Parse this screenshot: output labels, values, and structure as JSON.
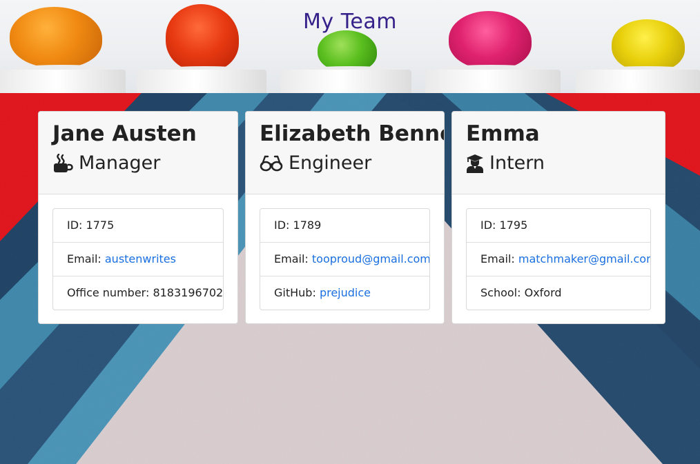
{
  "header": {
    "title": "My Team"
  },
  "cards": [
    {
      "name": "Jane Austen",
      "role": "Manager",
      "role_icon": "mug-icon",
      "id_label": "ID:",
      "id_value": "1775",
      "email_label": "Email:",
      "email_value": "austenwrites",
      "extra_label": "Office number:",
      "extra_value": "8183196702"
    },
    {
      "name": "Elizabeth Bennet",
      "role": "Engineer",
      "role_icon": "glasses-icon",
      "id_label": "ID:",
      "id_value": "1789",
      "email_label": "Email:",
      "email_value": "tooproud@gmail.com",
      "extra_label": "GitHub:",
      "extra_value": "prejudice"
    },
    {
      "name": "Emma",
      "role": "Intern",
      "role_icon": "graduate-icon",
      "id_label": "ID:",
      "id_value": "1795",
      "email_label": "Email:",
      "email_value": "matchmaker@gmail.com",
      "extra_label": "School:",
      "extra_value": "Oxford"
    }
  ],
  "colors": {
    "title": "#36218a",
    "link": "#1a6fe0",
    "background_red": "#e0141c",
    "background_navy": "#264d72",
    "background_teal": "#3f86aa",
    "background_pink": "#d9cdd0"
  }
}
